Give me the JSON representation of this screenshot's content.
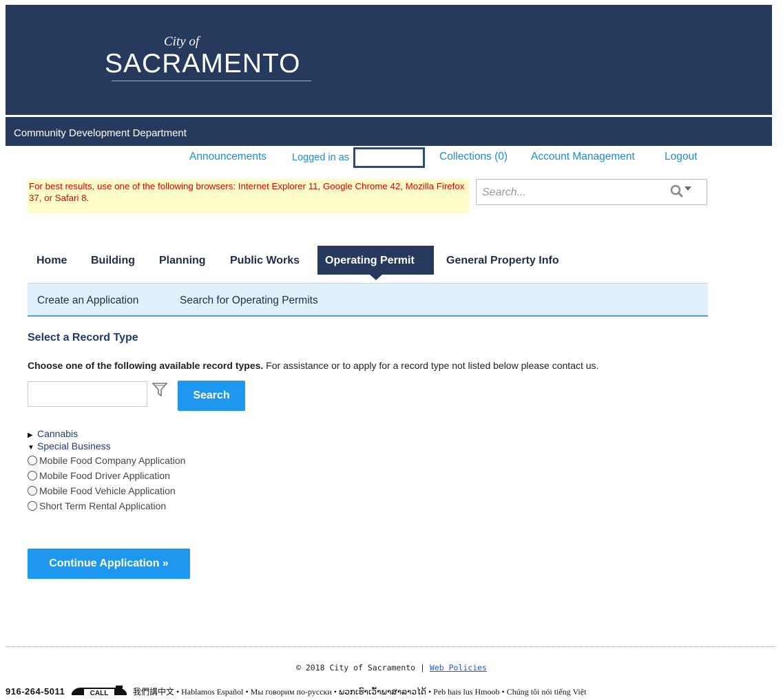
{
  "header": {
    "logo_small": "City of",
    "logo_big": "SACRAMENTO",
    "department": "Community Development Department"
  },
  "topnav": {
    "announcements": "Announcements",
    "logged_in_as": "Logged in as",
    "collections": "Collections (0)",
    "account_management": "Account Management",
    "logout": "Logout"
  },
  "browser_warning": "For best results, use one of the following browsers: Internet Explorer 11, Google Chrome 42, Mozilla Firefox 37, or Safari 8.",
  "global_search": {
    "placeholder": "Search..."
  },
  "mainnav": {
    "tabs": [
      {
        "label": "Home"
      },
      {
        "label": "Building"
      },
      {
        "label": "Planning"
      },
      {
        "label": "Public Works"
      },
      {
        "label": "Operating Permit",
        "active": true
      },
      {
        "label": "General Property Info"
      }
    ]
  },
  "subnav": {
    "items": [
      {
        "label": "Create an Application"
      },
      {
        "label": "Search for Operating Permits"
      }
    ]
  },
  "content": {
    "title": "Select a Record Type",
    "instructions_bold": "Choose one of the following available record types.",
    "instructions_rest": " For assistance or to apply for a record type not listed below please contact us.",
    "search_button": "Search",
    "tree": {
      "nodes": [
        {
          "label": "Cannabis",
          "expanded": false
        },
        {
          "label": "Special Business",
          "expanded": true
        }
      ],
      "options": [
        "Mobile Food Company Application",
        "Mobile Food Driver Application",
        "Mobile Food Vehicle Application",
        "Short Term Rental Application"
      ]
    },
    "continue_button": "Continue Application »"
  },
  "footer": {
    "copyright_prefix": "©  2018  City of Sacramento | ",
    "web_policies": "Web Policies",
    "phone": "916-264-5011",
    "call_label": "CALL",
    "languages": "我們講中文 • Hablamos Español • Мы говорим по-русски • ພວກເຮົາເວົ້າພາສາລາວໄດ້ • Peb hais lus Hmoob • Chúng tôi nói tiếng Việt"
  },
  "colors": {
    "header_navy": "#263a5e",
    "link_blue": "#1a8fd3",
    "button_blue": "#1e97ee",
    "warning_red": "#e00000",
    "warning_bg": "#fefcc8",
    "subnav_bg": "#e0f1fb"
  }
}
